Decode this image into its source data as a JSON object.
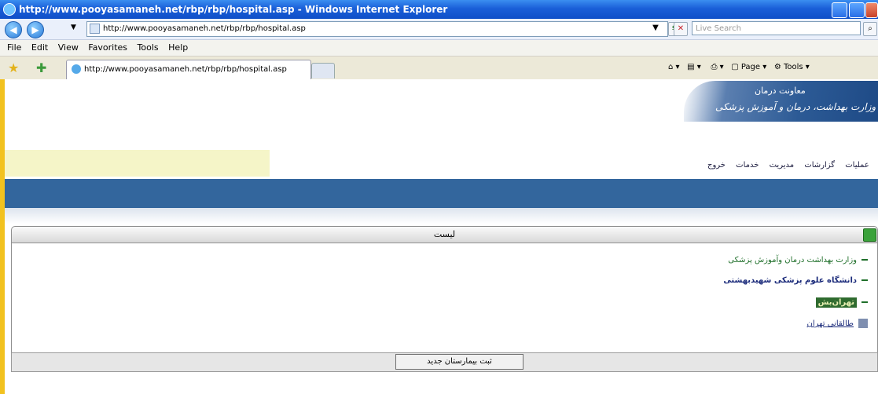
{
  "window": {
    "title": "http://www.pooyasamaneh.net/rbp/rbp/hospital.asp - Windows Internet Explorer"
  },
  "address_bar": {
    "url": "http://www.pooyasamaneh.net/rbp/rbp/hospital.asp",
    "search_placeholder": "Live Search"
  },
  "menu": {
    "items": [
      "File",
      "Edit",
      "View",
      "Favorites",
      "Tools",
      "Help"
    ]
  },
  "tabs": {
    "active_label": "http://www.pooyasamaneh.net/rbp/rbp/hospital.asp"
  },
  "command_bar": {
    "page_label": "Page",
    "tools_label": "Tools"
  },
  "site": {
    "banner_line1": "معاونت درمان",
    "banner_line2": "وزارت بهداشت، درمان و آموزش پزشکی",
    "nav": [
      "عملیات",
      "گزارشات",
      "مدیریت",
      "خدمات",
      "خروج"
    ]
  },
  "panel": {
    "title": "لیست",
    "tree": {
      "level1": "وزارت بهداشت درمان وآموزش پزشکی",
      "level2": "دانشگاه علوم پزشکی شهیدبهشتی",
      "level3": "تهران‌بش",
      "hospital": "طالقانی تهران"
    },
    "add_button_label": "ثبت بیمارستان جدید"
  }
}
